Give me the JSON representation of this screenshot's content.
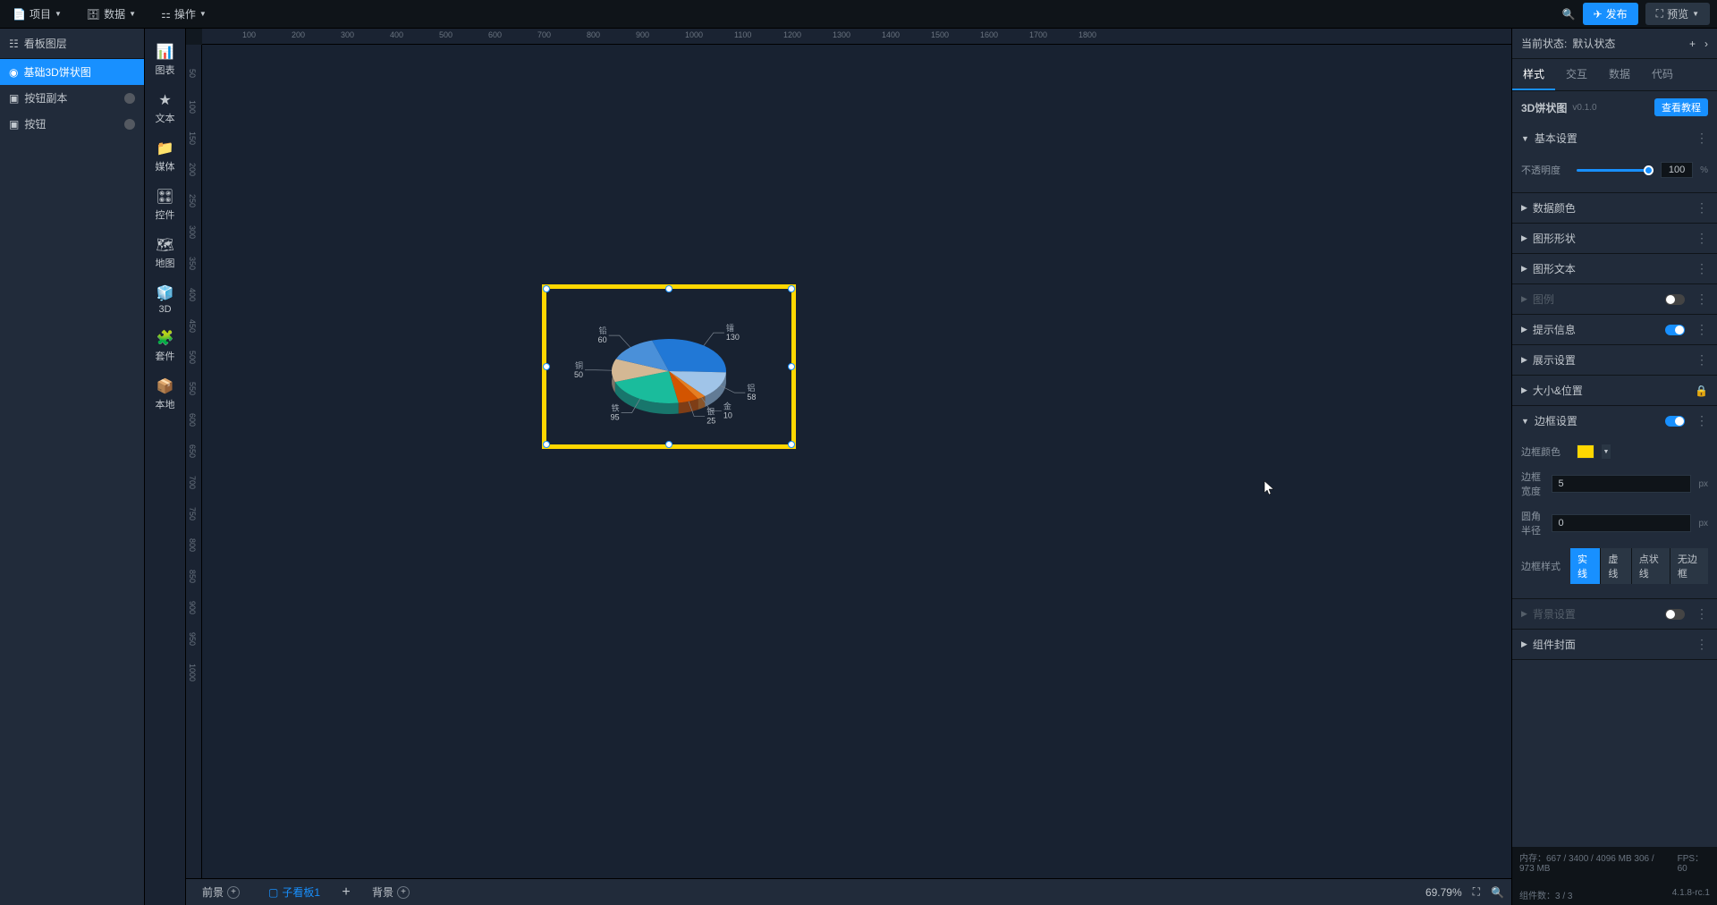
{
  "menu": {
    "project": "项目",
    "data": "数据",
    "action": "操作"
  },
  "top_right": {
    "publish": "发布",
    "preview": "预览"
  },
  "layers": {
    "title": "看板图层",
    "items": [
      {
        "label": "基础3D饼状图",
        "selected": true
      },
      {
        "label": "按钮副本",
        "selected": false
      },
      {
        "label": "按钮",
        "selected": false
      }
    ]
  },
  "vtoolbar": [
    {
      "label": "图表"
    },
    {
      "label": "文本"
    },
    {
      "label": "媒体"
    },
    {
      "label": "控件"
    },
    {
      "label": "地图"
    },
    {
      "label": "3D"
    },
    {
      "label": "套件"
    },
    {
      "label": "本地"
    }
  ],
  "ruler_h": [
    "100",
    "200",
    "300",
    "400",
    "500",
    "600",
    "700",
    "800",
    "900",
    "1000",
    "1100",
    "1200",
    "1300",
    "1400",
    "1500",
    "1600",
    "1700",
    "1800"
  ],
  "ruler_v": [
    "50",
    "100",
    "150",
    "200",
    "250",
    "300",
    "350",
    "400",
    "450",
    "500",
    "550",
    "600",
    "650",
    "700",
    "750",
    "800",
    "850",
    "900",
    "950",
    "1000"
  ],
  "chart_data": {
    "type": "pie",
    "series": [
      {
        "name": "镭",
        "value": 130,
        "color": "#2178d6"
      },
      {
        "name": "铝",
        "value": 58,
        "color": "#a0c4e8"
      },
      {
        "name": "金",
        "value": 10,
        "color": "#e67e22"
      },
      {
        "name": "银",
        "value": 25,
        "color": "#d35400"
      },
      {
        "name": "铁",
        "value": 95,
        "color": "#1abc9c"
      },
      {
        "name": "铜",
        "value": 50,
        "color": "#d4b894"
      },
      {
        "name": "铅",
        "value": 60,
        "color": "#4a90d9"
      }
    ]
  },
  "bottom": {
    "front": "前景",
    "sub_panel": "子看板1",
    "back": "背景",
    "zoom": "69.79%"
  },
  "right": {
    "status_label": "当前状态:",
    "status_value": "默认状态",
    "tabs": [
      "样式",
      "交互",
      "数据",
      "代码"
    ],
    "comp_name": "3D饼状图",
    "comp_version": "v0.1.0",
    "tutorial_btn": "查看教程",
    "sections": {
      "basic": "基本设置",
      "opacity_label": "不透明度",
      "opacity_value": "100",
      "opacity_unit": "%",
      "data_color": "数据颜色",
      "shape": "图形形状",
      "text": "图形文本",
      "legend": "图例",
      "tooltip": "提示信息",
      "display": "展示设置",
      "size_pos": "大小&位置",
      "border": "边框设置",
      "border_color": "边框颜色",
      "border_color_value": "#ffd700",
      "border_width": "边框宽度",
      "border_width_value": "5",
      "border_radius": "圆角半径",
      "border_radius_value": "0",
      "border_style": "边框样式",
      "border_styles": [
        "实线",
        "虚线",
        "点状线",
        "无边框"
      ],
      "border_style_active": "实线",
      "background": "背景设置",
      "cover": "组件封面",
      "px": "px"
    }
  },
  "footer": {
    "memory": "内存：667 / 3400 / 4096 MB  306 / 973 MB",
    "fps": "FPS：60",
    "comp_count": "组件数：3 / 3",
    "version": "4.1.8-rc.1"
  }
}
